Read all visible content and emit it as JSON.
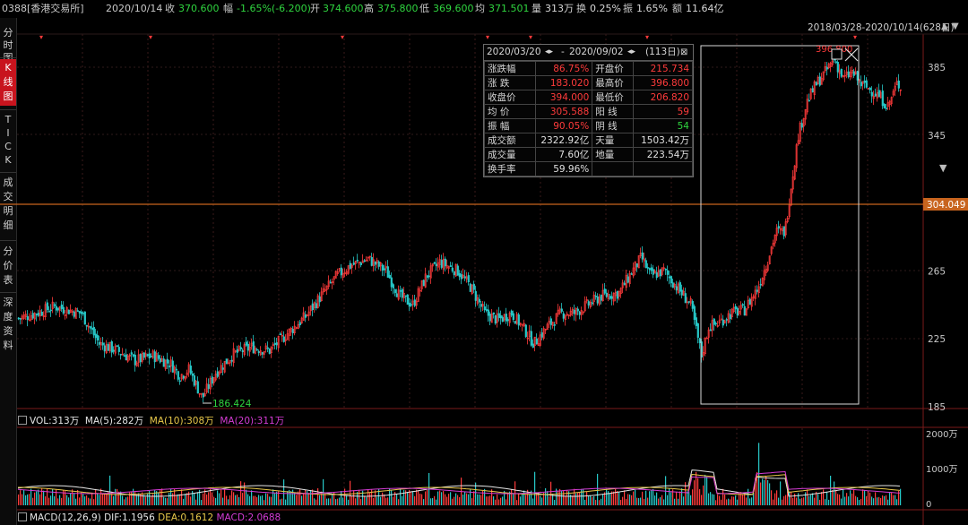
{
  "colors": {
    "up": "#ff3b3b",
    "down": "#27c8c8",
    "ma5": "#e6e6e6",
    "ma10": "#e8c84a",
    "ma20": "#d43cd4",
    "grid": "#3a2a2a",
    "refline": "#c8641e",
    "accent": "#c8141e"
  },
  "topbar": {
    "code": "0388[香港交易所]",
    "date": "2020/10/14",
    "close_label": "收",
    "close": "370.600",
    "change_label": "幅",
    "change": "-1.65%(-6.200)",
    "open_label": "开",
    "open": "374.600",
    "high_label": "高",
    "high": "375.800",
    "low_label": "低",
    "low": "369.600",
    "avg_label": "均",
    "avg": "371.501",
    "vol_label": "量",
    "vol": "313万",
    "turnover_label": "换",
    "turnover": "0.25%",
    "amp_label": "振",
    "amp": "1.65%",
    "amount_label": "额",
    "amount": "11.64亿"
  },
  "range_label": "2018/03/28-2020/10/14(628日)",
  "sidebar": [
    {
      "label": "分时图",
      "active": false
    },
    {
      "label": "K线图",
      "active": true
    },
    {
      "label": "TICK",
      "active": false
    },
    {
      "label": "成交明细",
      "active": false
    },
    {
      "label": "分价表",
      "active": false
    },
    {
      "label": "深度资料",
      "active": false
    }
  ],
  "price_axis": {
    "ticks": [
      "385",
      "345",
      "305",
      "265",
      "225",
      "185"
    ],
    "current": "304.049"
  },
  "low_marker": "186.424",
  "high_marker": "396.800",
  "statbox": {
    "header_start": "2020/03/20",
    "header_end": "2020/09/02",
    "header_days": "(113日)",
    "rows": [
      {
        "k": "涨跌幅",
        "v": "86.75%",
        "vc": "r",
        "k2": "开盘价",
        "v2": "215.734",
        "v2c": "r"
      },
      {
        "k": "涨 跌",
        "v": "183.020",
        "vc": "r",
        "k2": "最高价",
        "v2": "396.800",
        "v2c": "r"
      },
      {
        "k": "收盘价",
        "v": "394.000",
        "vc": "r",
        "k2": "最低价",
        "v2": "206.820",
        "v2c": "r"
      },
      {
        "k": "均 价",
        "v": "305.588",
        "vc": "r",
        "k2": "阳 线",
        "v2": "59",
        "v2c": "r"
      },
      {
        "k": "振 幅",
        "v": "90.05%",
        "vc": "r",
        "k2": "阴 线",
        "v2": "54",
        "v2c": "g"
      },
      {
        "k": "成交额",
        "v": "2322.92亿",
        "vc": "w",
        "k2": "天量",
        "v2": "1503.42万",
        "v2c": "w"
      },
      {
        "k": "成交量",
        "v": "7.60亿",
        "vc": "w",
        "k2": "地量",
        "v2": "223.54万",
        "v2c": "w"
      },
      {
        "k": "换手率",
        "v": "59.96%",
        "vc": "w",
        "k2": "",
        "v2": "",
        "v2c": "w"
      }
    ]
  },
  "volume_panel": {
    "vol_label": "VOL:313万",
    "ma5_label": "MA(5):282万",
    "ma10_label": "MA(10):308万",
    "ma20_label": "MA(20):311万",
    "ticks": [
      "2000万",
      "1000万",
      "0"
    ]
  },
  "macd_panel": {
    "title": "MACD(12,26,9)",
    "dif": "DIF:1.1956",
    "dea": "DEA:0.1612",
    "macd": "MACD:2.0688"
  }
}
